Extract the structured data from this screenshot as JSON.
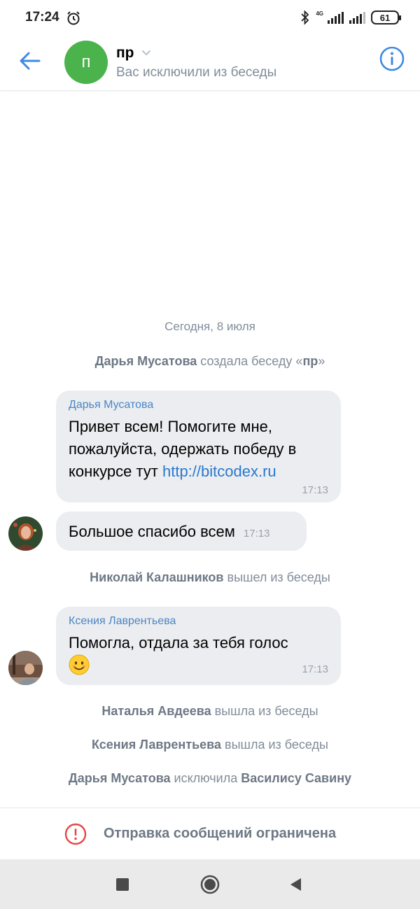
{
  "status_bar": {
    "time": "17:24",
    "network_type": "4G",
    "battery": "61"
  },
  "header": {
    "avatar_letter": "п",
    "title": "пр",
    "subtitle": "Вас исключили из беседы"
  },
  "date_separator": "Сегодня, 8 июля",
  "system_1": {
    "actor": "Дарья Мусатова",
    "action": " создала беседу «",
    "target": "пр",
    "suffix": "»"
  },
  "message_1": {
    "author": "Дарья Мусатова",
    "text_before_link": "Привет всем! Помогите мне, пожалуйста, одержать победу в конкурсе тут ",
    "link": "http://bitcodex.ru",
    "time": "17:13"
  },
  "message_2": {
    "text": "Большое спасибо всем",
    "time": "17:13"
  },
  "system_2": {
    "actor": "Николай Калашников",
    "action": " вышел из беседы"
  },
  "message_3": {
    "author": "Ксения Лаврентьева",
    "text": "Помогла, отдала за тебя голос",
    "emoji": "smiling-face-icon",
    "time": "17:13"
  },
  "system_3": {
    "actor": "Наталья Авдеева",
    "action": " вышла из беседы"
  },
  "system_4": {
    "actor": "Ксения Лаврентьева",
    "action": " вышла из беседы"
  },
  "system_5": {
    "actor": "Дарья Мусатова",
    "action": " исключила ",
    "target": "Василису Савину"
  },
  "restriction": {
    "text": "Отправка сообщений ограничена"
  },
  "colors": {
    "accent": "#3f8ae0",
    "avatar_green": "#4bb34b",
    "bubble_bg": "#ebedf0",
    "secondary_text": "#818c99",
    "warning_red": "#e64646"
  }
}
